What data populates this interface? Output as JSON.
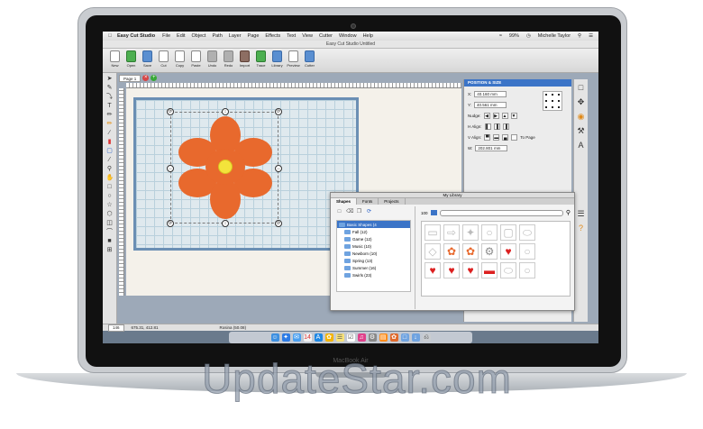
{
  "menubar": {
    "app_name": "Easy Cut Studio",
    "items": [
      "File",
      "Edit",
      "Object",
      "Path",
      "Layer",
      "Page",
      "Effects",
      "Text",
      "View",
      "Cutter",
      "Window",
      "Help"
    ],
    "battery": "99%",
    "user": "Michelle Taylor"
  },
  "window": {
    "title": "Easy Cut Studio Untitled"
  },
  "toolbar": {
    "new": "New",
    "open": "Open",
    "save": "Save",
    "cut": "Cut",
    "copy": "Copy",
    "paste": "Paste",
    "undo": "Undo",
    "redo": "Redo",
    "import": "Import",
    "trace": "Trace",
    "library": "Library",
    "preview": "Preview",
    "cutter": "Cutter"
  },
  "document": {
    "page_tab": "Page 1"
  },
  "position_panel": {
    "header": "POSITION & SIZE",
    "x_label": "X:",
    "x_value": "40.160 mm",
    "y_label": "Y:",
    "y_value": "40.561 mm",
    "nudge_label": "Nudge:",
    "h_align_label": "H Align:",
    "v_align_label": "V Align:",
    "to_page": "To Page",
    "w_label": "W:",
    "w_value": "202.801 mm"
  },
  "library": {
    "title": "My Library",
    "tabs": [
      "Shapes",
      "Fonts",
      "Projects"
    ],
    "size_value": "100",
    "tree": [
      "Basic Shapes (4",
      "Fall (12)",
      "Game (12)",
      "Music (10)",
      "Newborn (10)",
      "Spring (13)",
      "Summer (16)",
      "Swirls (23)"
    ],
    "shapes": [
      {
        "glyph": "▭",
        "color": "none"
      },
      {
        "glyph": "⇨",
        "color": "none"
      },
      {
        "glyph": "✦",
        "color": "none"
      },
      {
        "glyph": "○",
        "color": "none"
      },
      {
        "glyph": "▢",
        "color": "none"
      },
      {
        "glyph": "⬭",
        "color": "none"
      },
      {
        "glyph": "◇",
        "color": "none"
      },
      {
        "glyph": "✿",
        "color": "orange"
      },
      {
        "glyph": "✿",
        "color": "orange"
      },
      {
        "glyph": "⚙",
        "color": "grey"
      },
      {
        "glyph": "♥",
        "color": "red"
      },
      {
        "glyph": "○",
        "color": "none"
      },
      {
        "glyph": "♥",
        "color": "red"
      },
      {
        "glyph": "♥",
        "color": "red"
      },
      {
        "glyph": "♥",
        "color": "red"
      },
      {
        "glyph": "▬",
        "color": "red"
      },
      {
        "glyph": "⬭",
        "color": "none"
      },
      {
        "glyph": "○",
        "color": "none"
      }
    ]
  },
  "statusbar": {
    "zoom": "146",
    "coords": "675.31, 412.81",
    "selection": "Rosina (50.08)"
  },
  "device": {
    "label": "MacBook Air"
  },
  "watermark": "UpdateStar.com"
}
